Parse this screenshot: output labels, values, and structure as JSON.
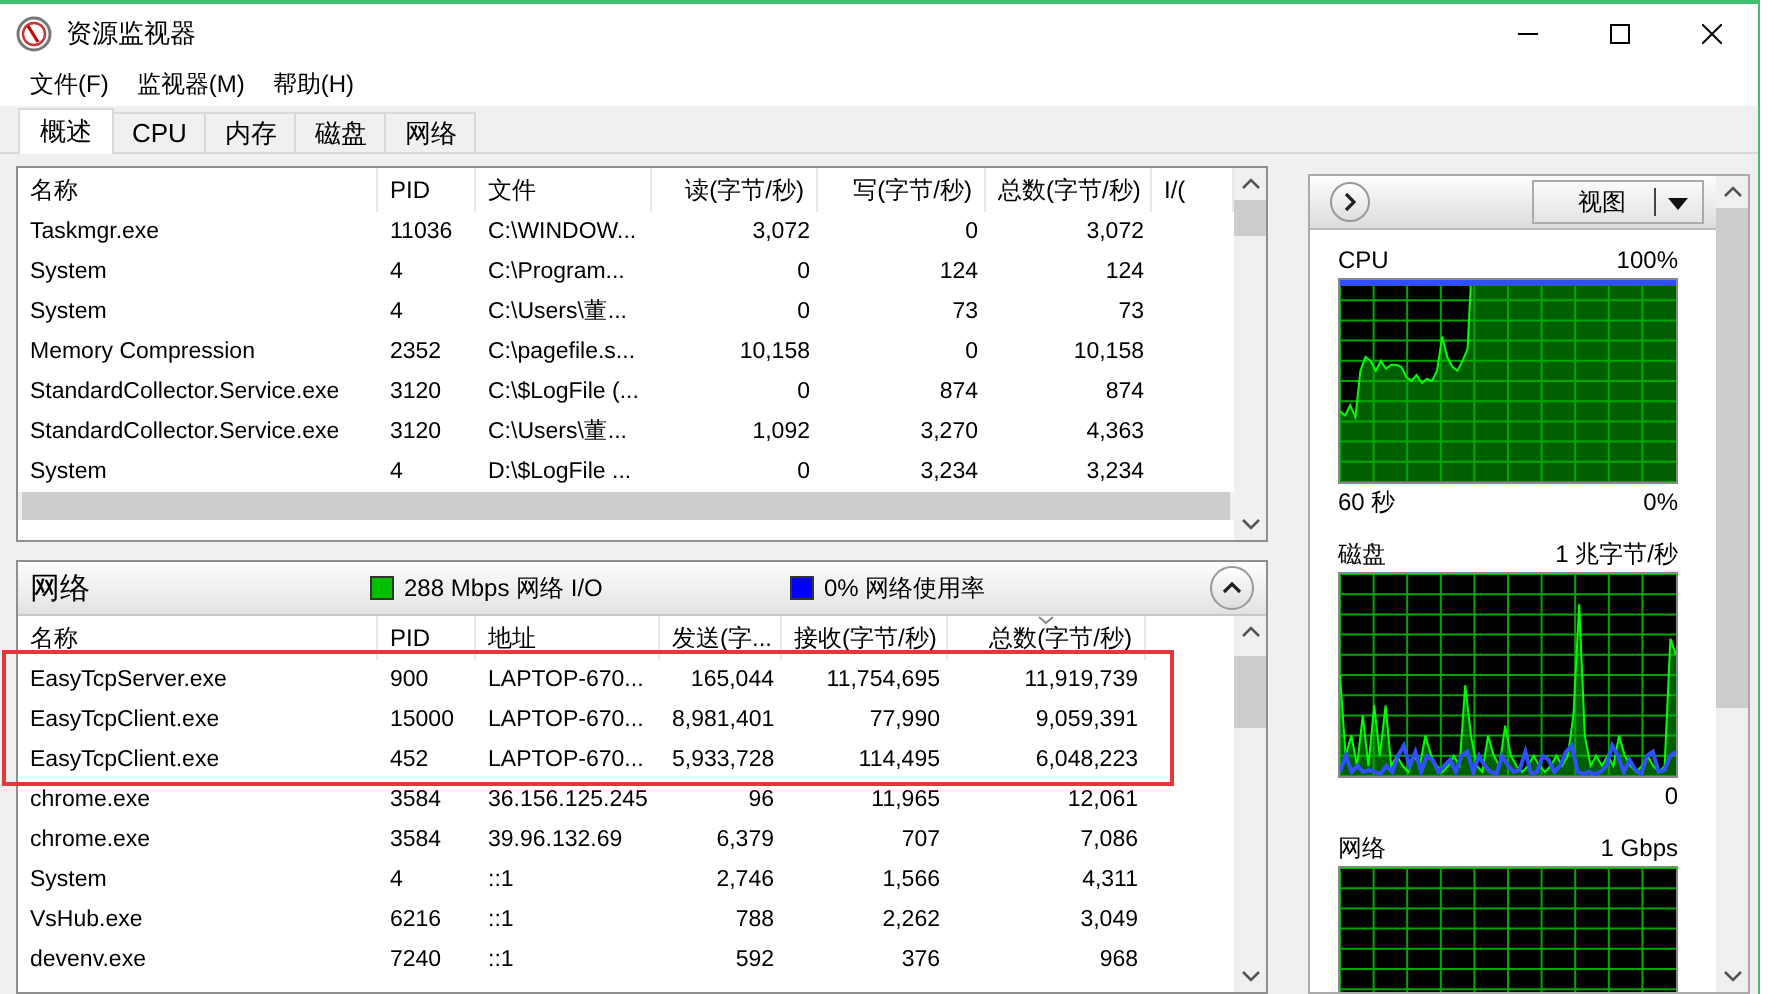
{
  "window": {
    "title": "资源监视器"
  },
  "menu": [
    {
      "label": "文件(F)"
    },
    {
      "label": "监视器(M)"
    },
    {
      "label": "帮助(H)"
    }
  ],
  "tabs": [
    {
      "label": "概述",
      "selected": true
    },
    {
      "label": "CPU",
      "selected": false
    },
    {
      "label": "内存",
      "selected": false
    },
    {
      "label": "磁盘",
      "selected": false
    },
    {
      "label": "网络",
      "selected": false
    }
  ],
  "disk_table": {
    "columns": [
      {
        "label": "名称",
        "kind": "text"
      },
      {
        "label": "PID",
        "kind": "text"
      },
      {
        "label": "文件",
        "kind": "text"
      },
      {
        "label": "读(字节/秒)",
        "kind": "number"
      },
      {
        "label": "写(字节/秒)",
        "kind": "number"
      },
      {
        "label": "总数(字节/秒)",
        "kind": "number"
      },
      {
        "label": "I/(",
        "kind": "text"
      }
    ],
    "rows": [
      {
        "cells": [
          "Taskmgr.exe",
          "11036",
          "C:\\WINDOW...",
          "3,072",
          "0",
          "3,072"
        ]
      },
      {
        "cells": [
          "System",
          "4",
          "C:\\Program...",
          "0",
          "124",
          "124"
        ]
      },
      {
        "cells": [
          "System",
          "4",
          "C:\\Users\\董...",
          "0",
          "73",
          "73"
        ]
      },
      {
        "cells": [
          "Memory Compression",
          "2352",
          "C:\\pagefile.s...",
          "10,158",
          "0",
          "10,158"
        ]
      },
      {
        "cells": [
          "StandardCollector.Service.exe",
          "3120",
          "C:\\$LogFile (...",
          "0",
          "874",
          "874"
        ]
      },
      {
        "cells": [
          "StandardCollector.Service.exe",
          "3120",
          "C:\\Users\\董...",
          "1,092",
          "3,270",
          "4,363"
        ]
      },
      {
        "cells": [
          "System",
          "4",
          "D:\\$LogFile ...",
          "0",
          "3,234",
          "3,234"
        ]
      }
    ]
  },
  "network": {
    "title": "网络",
    "expanded": true,
    "legends": [
      {
        "text": "288 Mbps 网络 I/O",
        "color": "#00c000"
      },
      {
        "text": "0% 网络使用率",
        "color": "#0000ff"
      }
    ],
    "columns": [
      {
        "label": "名称",
        "kind": "text",
        "sorted": false
      },
      {
        "label": "PID",
        "kind": "text",
        "sorted": false
      },
      {
        "label": "地址",
        "kind": "text",
        "sorted": false
      },
      {
        "label": "发送(字...",
        "kind": "number",
        "sorted": false
      },
      {
        "label": "接收(字节/秒)",
        "kind": "number",
        "sorted": false
      },
      {
        "label": "总数(字节/秒)",
        "kind": "number",
        "sorted": true
      }
    ],
    "rows": [
      {
        "cells": [
          "EasyTcpServer.exe",
          "900",
          "LAPTOP-670...",
          "165,044",
          "11,754,695",
          "11,919,739"
        ],
        "highlighted": true
      },
      {
        "cells": [
          "EasyTcpClient.exe",
          "15000",
          "LAPTOP-670...",
          "8,981,401",
          "77,990",
          "9,059,391"
        ],
        "highlighted": true
      },
      {
        "cells": [
          "EasyTcpClient.exe",
          "452",
          "LAPTOP-670...",
          "5,933,728",
          "114,495",
          "6,048,223"
        ],
        "highlighted": true
      },
      {
        "cells": [
          "chrome.exe",
          "3584",
          "36.156.125.245",
          "96",
          "11,965",
          "12,061"
        ],
        "highlighted": false
      },
      {
        "cells": [
          "chrome.exe",
          "3584",
          "39.96.132.69",
          "6,379",
          "707",
          "7,086"
        ],
        "highlighted": false
      },
      {
        "cells": [
          "System",
          "4",
          "::1",
          "2,746",
          "1,566",
          "4,311"
        ],
        "highlighted": false
      },
      {
        "cells": [
          "VsHub.exe",
          "6216",
          "::1",
          "788",
          "2,262",
          "3,049"
        ],
        "highlighted": false
      },
      {
        "cells": [
          "devenv.exe",
          "7240",
          "::1",
          "592",
          "376",
          "968"
        ],
        "highlighted": false
      }
    ]
  },
  "side_panel": {
    "view_button": "视图",
    "graphs": [
      {
        "kind": "cpu",
        "title": "CPU",
        "scale": "100%",
        "time": "60 秒",
        "floor": "0%"
      },
      {
        "kind": "disk",
        "title": "磁盘",
        "scale": "1 兆字节/秒",
        "floor": "0"
      },
      {
        "kind": "network",
        "title": "网络",
        "scale": "1 Gbps"
      }
    ]
  }
}
